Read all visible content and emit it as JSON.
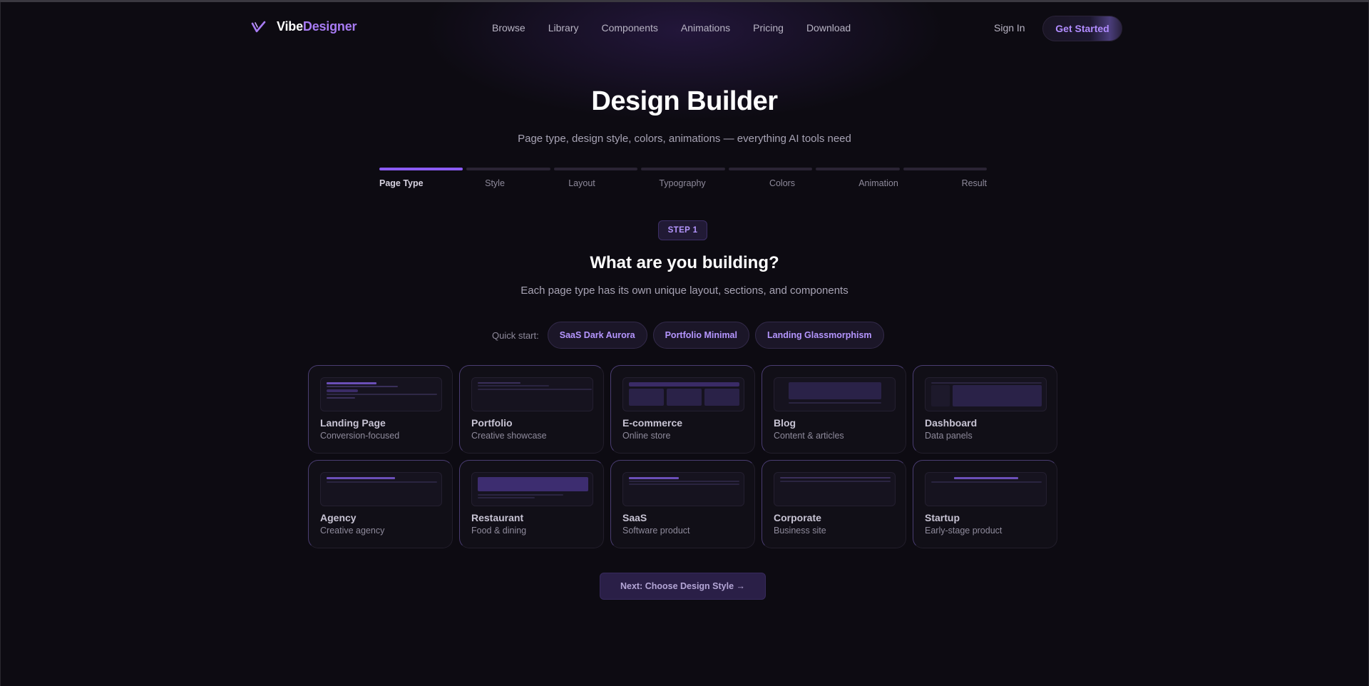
{
  "nav": {
    "brand_a": "Vibe",
    "brand_b": "Designer",
    "links": [
      "Browse",
      "Library",
      "Components",
      "Animations",
      "Pricing",
      "Download"
    ],
    "sign_in": "Sign In",
    "get_started": "Get Started"
  },
  "hero": {
    "title": "Design Builder",
    "subtitle": "Page type, design style, colors, animations — everything AI tools need"
  },
  "steps": {
    "labels": [
      "Page Type",
      "Style",
      "Layout",
      "Typography",
      "Colors",
      "Animation",
      "Result"
    ],
    "current": 0
  },
  "question": {
    "badge": "STEP 1",
    "title": "What are you building?",
    "subtitle": "Each page type has its own unique layout, sections, and components"
  },
  "quick_start": {
    "label": "Quick start:",
    "chips": [
      "SaaS Dark Aurora",
      "Portfolio Minimal",
      "Landing Glassmorphism"
    ]
  },
  "page_types": [
    {
      "name": "Landing Page",
      "desc": "Conversion-focused"
    },
    {
      "name": "Portfolio",
      "desc": "Creative showcase"
    },
    {
      "name": "E-commerce",
      "desc": "Online store"
    },
    {
      "name": "Blog",
      "desc": "Content & articles"
    },
    {
      "name": "Dashboard",
      "desc": "Data panels"
    },
    {
      "name": "Agency",
      "desc": "Creative agency"
    },
    {
      "name": "Restaurant",
      "desc": "Food & dining"
    },
    {
      "name": "SaaS",
      "desc": "Software product"
    },
    {
      "name": "Corporate",
      "desc": "Business site"
    },
    {
      "name": "Startup",
      "desc": "Early-stage product"
    }
  ],
  "next_button": "Next: Choose Design Style →",
  "colors": {
    "accent": "#8b5cf6",
    "accent_text": "#b596ff",
    "background": "#0d0b12"
  }
}
